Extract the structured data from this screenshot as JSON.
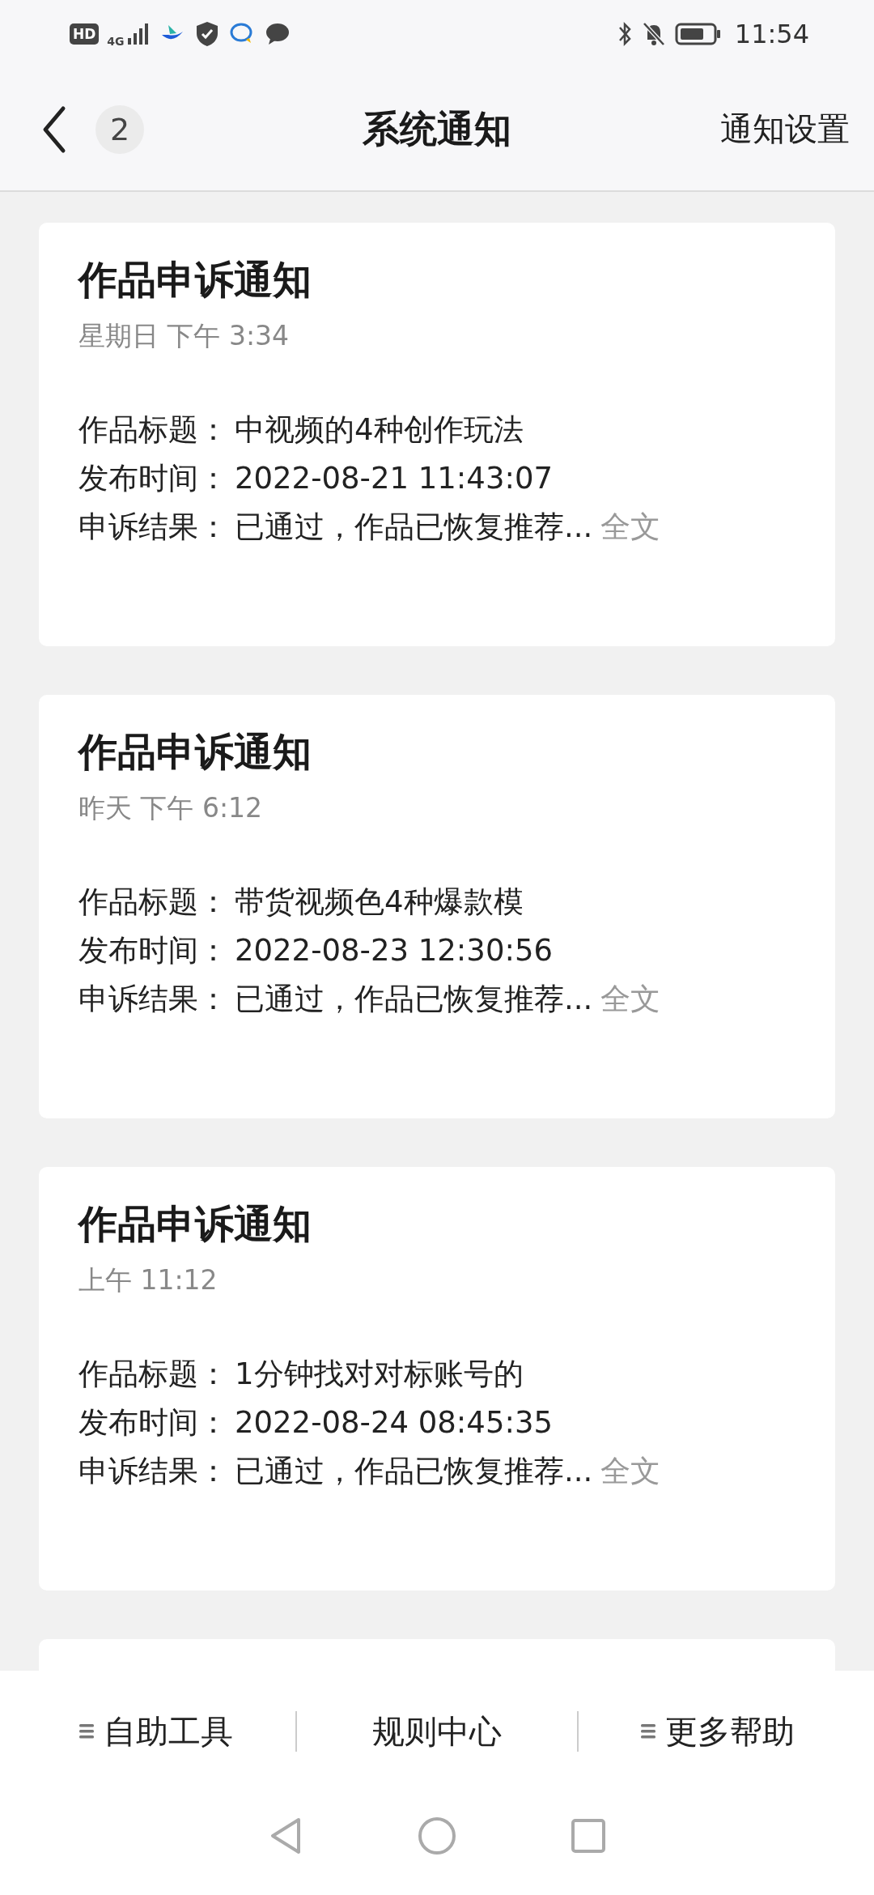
{
  "status_bar": {
    "hd": "HD",
    "network": "4G",
    "time": "11:54"
  },
  "header": {
    "unread_count": "2",
    "title": "系统通知",
    "action": "通知设置"
  },
  "notifications": [
    {
      "kind": "full",
      "title": "作品申诉通知",
      "time": "星期日 下午 3:34",
      "fields": [
        {
          "label": "作品标题：",
          "value": "中视频的4种创作玩法"
        },
        {
          "label": "发布时间：",
          "value": "2022-08-21 11:43:07"
        },
        {
          "label": "申诉结果：",
          "value": "已通过，作品已恢复推荐...",
          "more": "全文"
        }
      ]
    },
    {
      "kind": "full",
      "title": "作品申诉通知",
      "time": "昨天 下午 6:12",
      "fields": [
        {
          "label": "作品标题：",
          "value": "带货视频色4种爆款模"
        },
        {
          "label": "发布时间：",
          "value": "2022-08-23 12:30:56"
        },
        {
          "label": "申诉结果：",
          "value": "已通过，作品已恢复推荐...",
          "more": "全文"
        }
      ]
    },
    {
      "kind": "full",
      "title": "作品申诉通知",
      "time": "上午 11:12",
      "fields": [
        {
          "label": "作品标题：",
          "value": "1分钟找对对标账号的"
        },
        {
          "label": "发布时间：",
          "value": "2022-08-24 08:45:35"
        },
        {
          "label": "申诉结果：",
          "value": "已通过，作品已恢复推荐...",
          "more": "全文"
        }
      ]
    },
    {
      "kind": "partial"
    }
  ],
  "bottom_tabs": [
    {
      "label": "自助工具",
      "menu_icon": true
    },
    {
      "label": "规则中心",
      "menu_icon": false
    },
    {
      "label": "更多帮助",
      "menu_icon": true
    }
  ]
}
